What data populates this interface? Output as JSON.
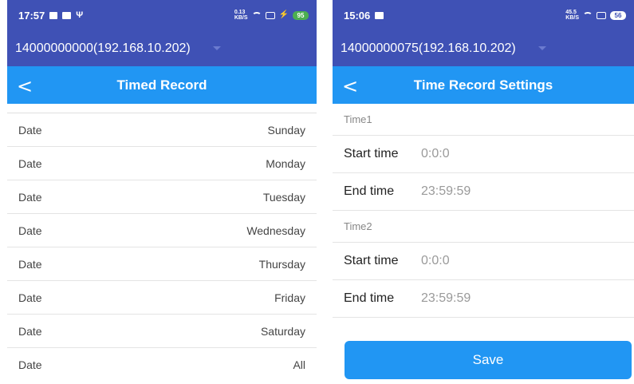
{
  "left": {
    "status": {
      "time": "17:57",
      "netspeed_top": "0.13",
      "netspeed_bottom": "KB/S",
      "battery": "95",
      "battery_color": "#4caf50"
    },
    "device": "14000000000(192.168.10.202)",
    "title": "Timed Record",
    "rows": [
      {
        "label": "Date",
        "value": "Sunday"
      },
      {
        "label": "Date",
        "value": "Monday"
      },
      {
        "label": "Date",
        "value": "Tuesday"
      },
      {
        "label": "Date",
        "value": "Wednesday"
      },
      {
        "label": "Date",
        "value": "Thursday"
      },
      {
        "label": "Date",
        "value": "Friday"
      },
      {
        "label": "Date",
        "value": "Saturday"
      },
      {
        "label": "Date",
        "value": "All"
      }
    ]
  },
  "right": {
    "status": {
      "time": "15:06",
      "netspeed_top": "45.5",
      "netspeed_bottom": "KB/S",
      "battery": "56",
      "battery_color": "#ffffff"
    },
    "device": "14000000075(192.168.10.202)",
    "title": "Time Record Settings",
    "time1": {
      "header": "Time1",
      "start_label": "Start time",
      "start_value": "0:0:0",
      "end_label": "End time",
      "end_value": "23:59:59"
    },
    "time2": {
      "header": "Time2",
      "start_label": "Start time",
      "start_value": "0:0:0",
      "end_label": "End time",
      "end_value": "23:59:59"
    },
    "save_label": "Save"
  },
  "colors": {
    "status_bar": "#3f51b5",
    "title_bar": "#2196f3",
    "save_button": "#2196f3"
  },
  "icons": [
    "image-icon",
    "mail-icon",
    "usb-icon",
    "wifi-icon",
    "screen-icon",
    "charging-icon",
    "battery-icon",
    "back-arrow-icon",
    "dropdown-arrow-icon"
  ]
}
